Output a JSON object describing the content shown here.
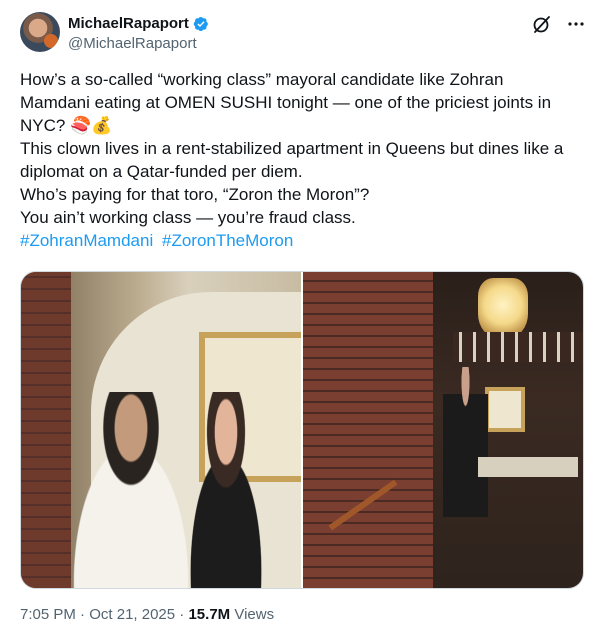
{
  "author": {
    "display_name": "MichaelRapaport",
    "handle": "@MichaelRapaport"
  },
  "icons": {
    "avatar": "avatar",
    "verified": "verified-badge-icon",
    "grok": "grok-icon",
    "more": "more-icon"
  },
  "colors": {
    "link": "#1d9bf0",
    "verified": "#1d9bf0",
    "text": "#0f1419",
    "muted": "#536471"
  },
  "tweet": {
    "lines": [
      "How’s a so-called “working class” mayoral candidate like Zohran",
      "Mamdani eating at OMEN SUSHI tonight — one of the priciest joints in",
      "NYC? 🍣💰",
      "This clown lives in a rent-stabilized apartment in Queens but dines like a",
      "diplomat on a Qatar-funded per diem.",
      "Who’s paying for that toro, “Zoron the Moron”?",
      "You ain’t working class — you’re fraud class."
    ],
    "hashtags": [
      "#ZohranMamdani",
      "#ZoronTheMoron"
    ]
  },
  "meta": {
    "time": "7:05 PM",
    "separator": "·",
    "date": "Oct 21, 2025",
    "views_count": "15.7M",
    "views_label": "Views"
  }
}
